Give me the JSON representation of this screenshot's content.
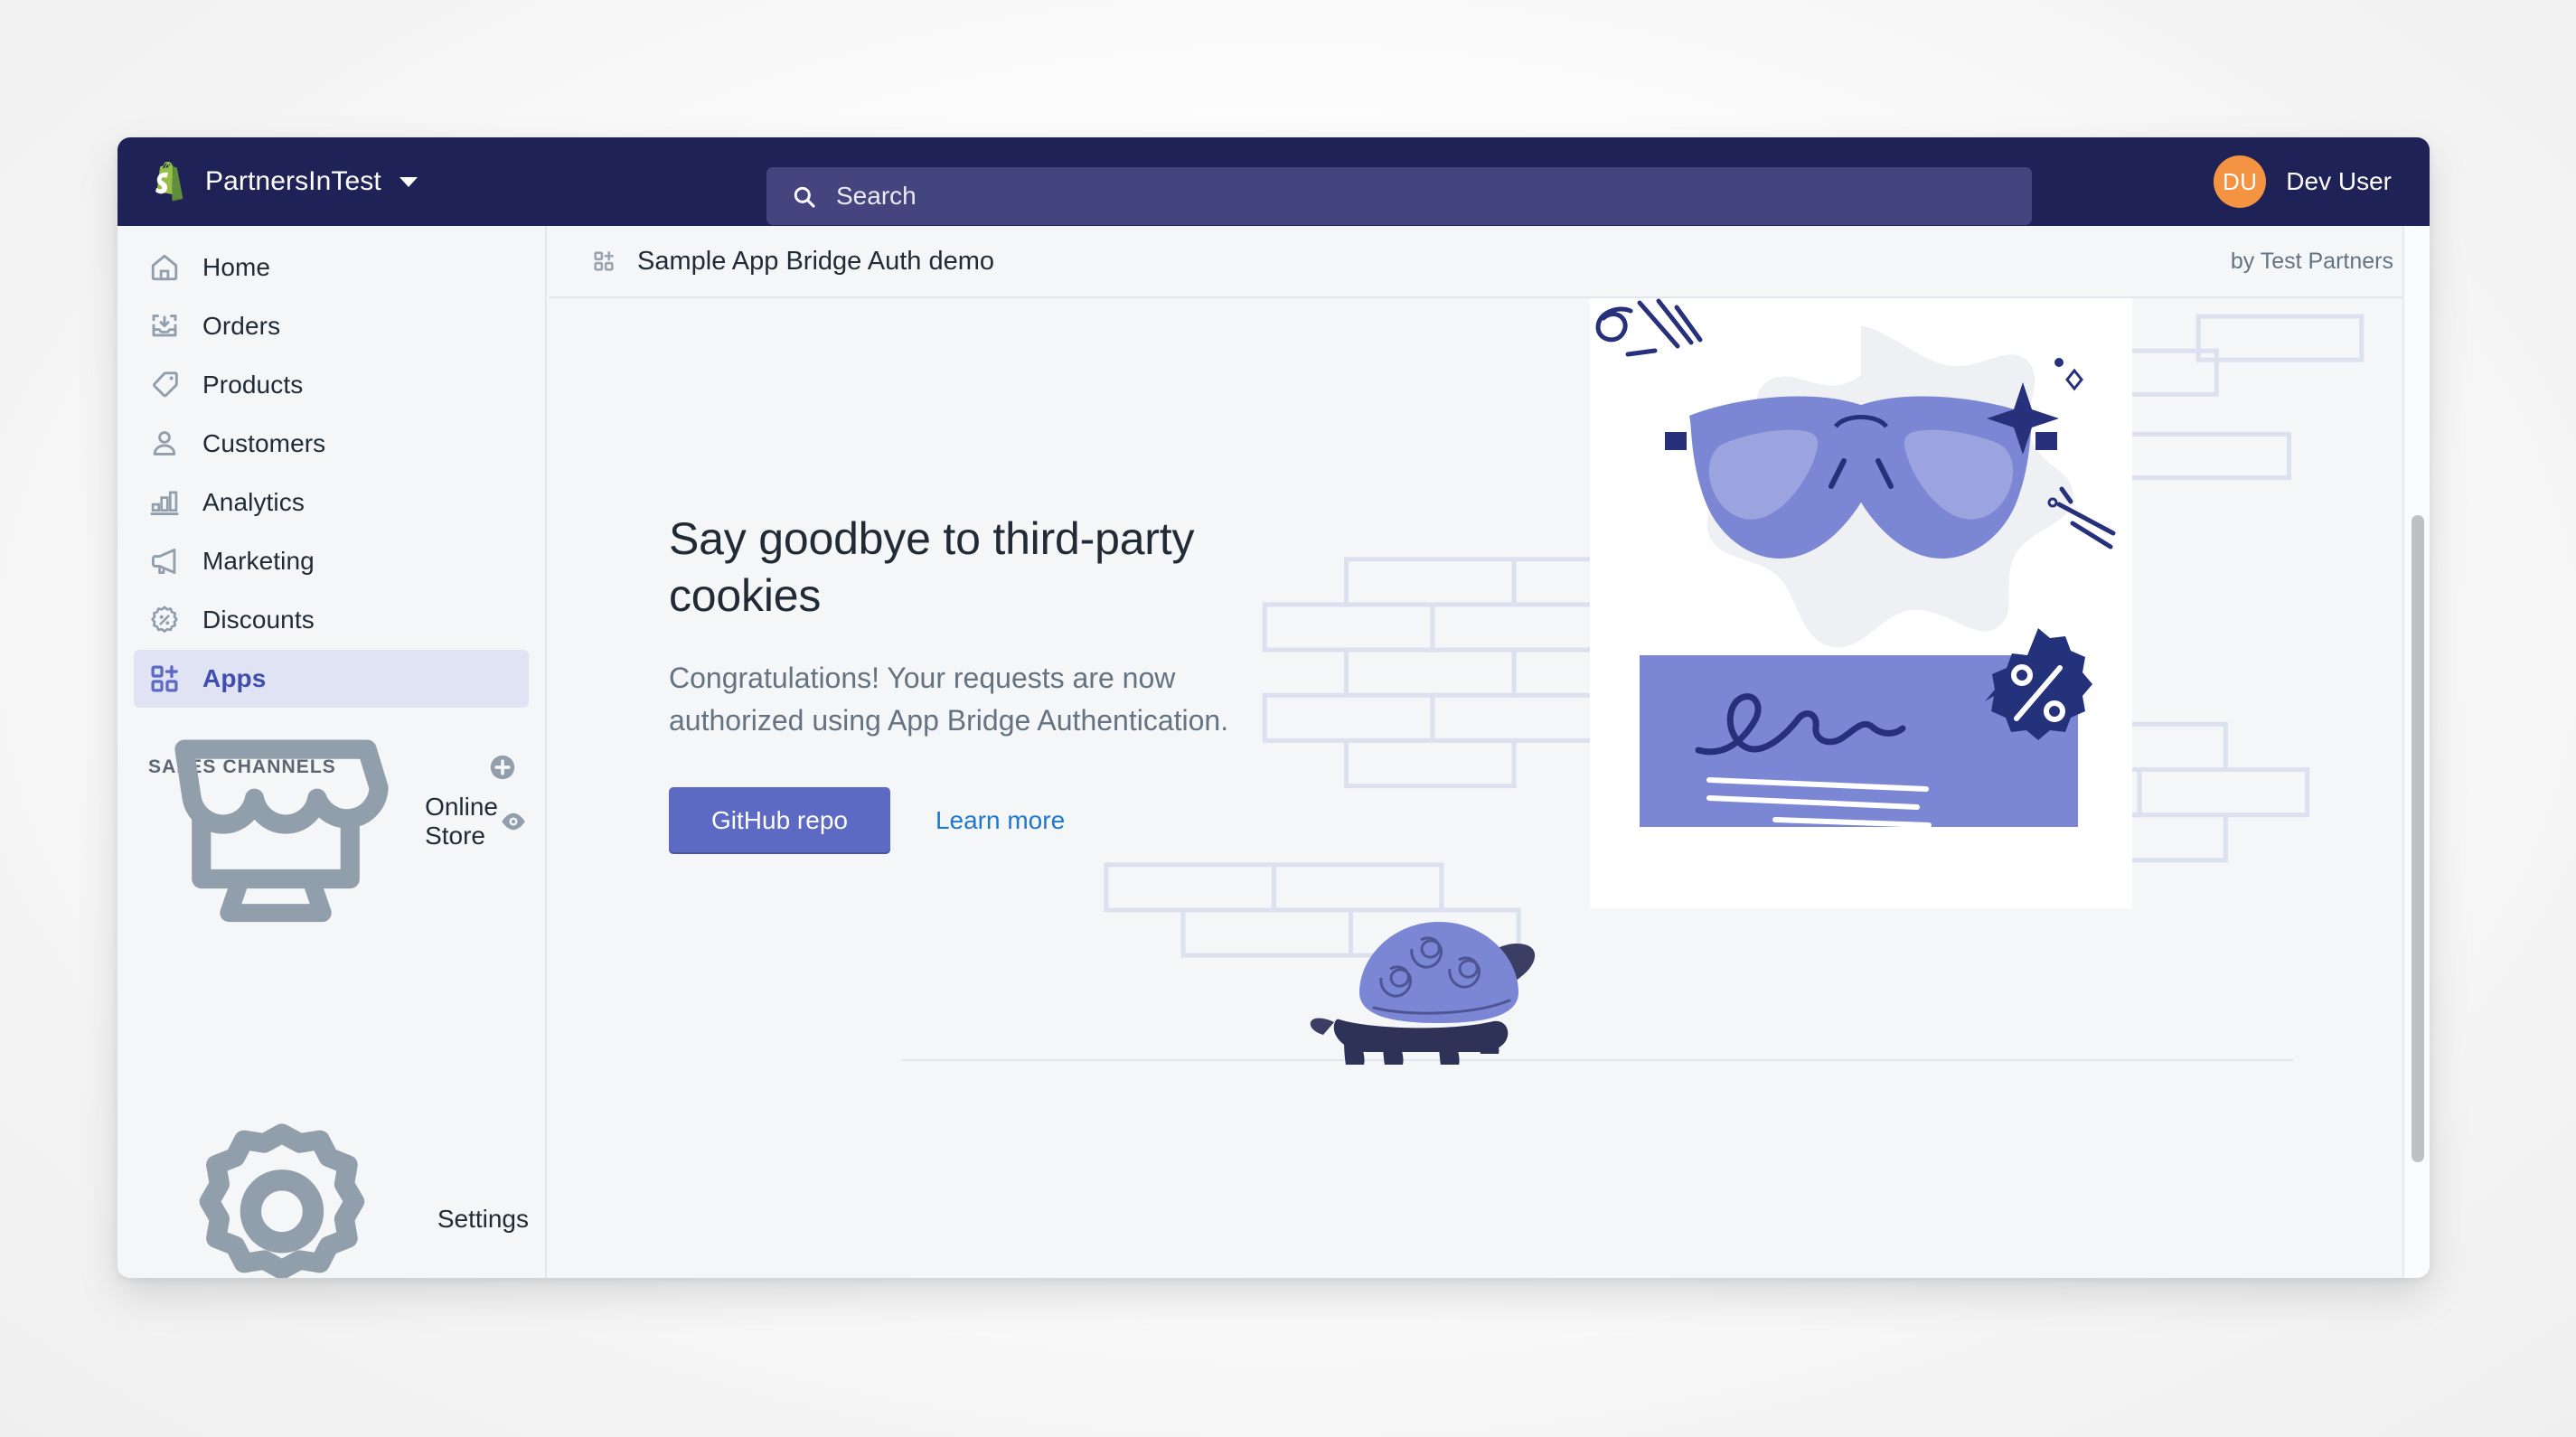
{
  "topbar": {
    "logo_icon": "shopify-bag-icon",
    "store_name": "PartnersInTest",
    "store_switcher_icon": "chevron-down-icon",
    "search": {
      "icon": "search-icon",
      "placeholder": "Search",
      "value": ""
    },
    "user": {
      "avatar_initials": "DU",
      "name": "Dev User",
      "avatar_color": "#f49342"
    },
    "background_color": "#1f2257",
    "search_background_color": "#44447f"
  },
  "sidebar": {
    "items": [
      {
        "label": "Home",
        "icon": "home-icon",
        "active": false
      },
      {
        "label": "Orders",
        "icon": "orders-inbox-icon",
        "active": false
      },
      {
        "label": "Products",
        "icon": "product-tag-icon",
        "active": false
      },
      {
        "label": "Customers",
        "icon": "customer-person-icon",
        "active": false
      },
      {
        "label": "Analytics",
        "icon": "analytics-bar-chart-icon",
        "active": false
      },
      {
        "label": "Marketing",
        "icon": "marketing-megaphone-icon",
        "active": false
      },
      {
        "label": "Discounts",
        "icon": "discount-percent-icon",
        "active": false
      },
      {
        "label": "Apps",
        "icon": "apps-grid-plus-icon",
        "active": true
      }
    ],
    "sales_channels": {
      "title": "SALES CHANNELS",
      "add_icon": "add-circle-icon",
      "channels": [
        {
          "label": "Online Store",
          "icon": "online-store-icon",
          "action_icon": "view-eye-icon"
        }
      ]
    },
    "settings": {
      "label": "Settings",
      "icon": "gear-icon"
    },
    "active_background_color": "#dfe3f3",
    "active_text_color": "#3f4eae"
  },
  "app_header": {
    "icon": "apps-grid-plus-icon",
    "title": "Sample App Bridge Auth demo",
    "author": "by Test Partners"
  },
  "app_content": {
    "headline": "Say goodbye to third-party cookies",
    "body": "Congratulations! Your requests are now authorized using App Bridge Authentication.",
    "primary_button": "GitHub repo",
    "secondary_link": "Learn more",
    "illustration": {
      "name": "sunglasses-and-turtle-illustration",
      "elements": [
        "sunglasses-icon",
        "signature-card",
        "percent-badge-icon",
        "turtle-icon",
        "brick-wall-pattern"
      ],
      "primary_color": "#5c6ac4",
      "accent_color": "#7b86d4",
      "dark_color": "#1f2b6b"
    },
    "button_color": "#5c6ac4",
    "link_color": "#1f77d0"
  },
  "scrollbar": {
    "name": "vertical-scrollbar",
    "thumb_color": "#c0c0c0"
  }
}
